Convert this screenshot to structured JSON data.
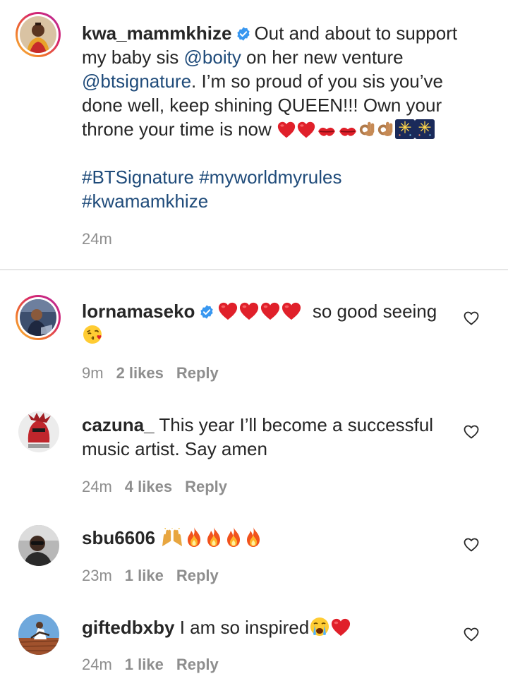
{
  "post": {
    "username": "kwa_mammkhize",
    "text_1": "Out and about to support my baby sis ",
    "mention_1": "@boity",
    "text_2": " on her new venture ",
    "mention_2": "@btsignature",
    "text_3": ". I’m so proud of you sis you’ve done well, keep shining QUEEN!!! Own your throne your time is now",
    "hashtag_line_1": "#BTSignature #myworldmyrules",
    "hashtag_line_2": "#kwamamkhize",
    "time": "24m"
  },
  "comments": [
    {
      "username": "lornamaseko",
      "verified": true,
      "text": "so good seeing",
      "time": "9m",
      "likes": "2 likes",
      "reply": "Reply"
    },
    {
      "username": "cazuna_",
      "verified": false,
      "text": "This year I’ll become a successful music artist. Say amen",
      "time": "24m",
      "likes": "4 likes",
      "reply": "Reply"
    },
    {
      "username": "sbu6606",
      "verified": false,
      "text": "",
      "time": "23m",
      "likes": "1 like",
      "reply": "Reply"
    },
    {
      "username": "giftedbxby",
      "verified": false,
      "text": "I am so inspired",
      "time": "24m",
      "likes": "1 like",
      "reply": "Reply"
    }
  ],
  "icons": {
    "verified": "verified-badge-icon",
    "like": "heart-outline-icon"
  },
  "colors": {
    "link": "#1f4b7a",
    "meta": "#8e8e8e",
    "verified": "#3897f0",
    "heart_emoji": "#e0202a"
  }
}
